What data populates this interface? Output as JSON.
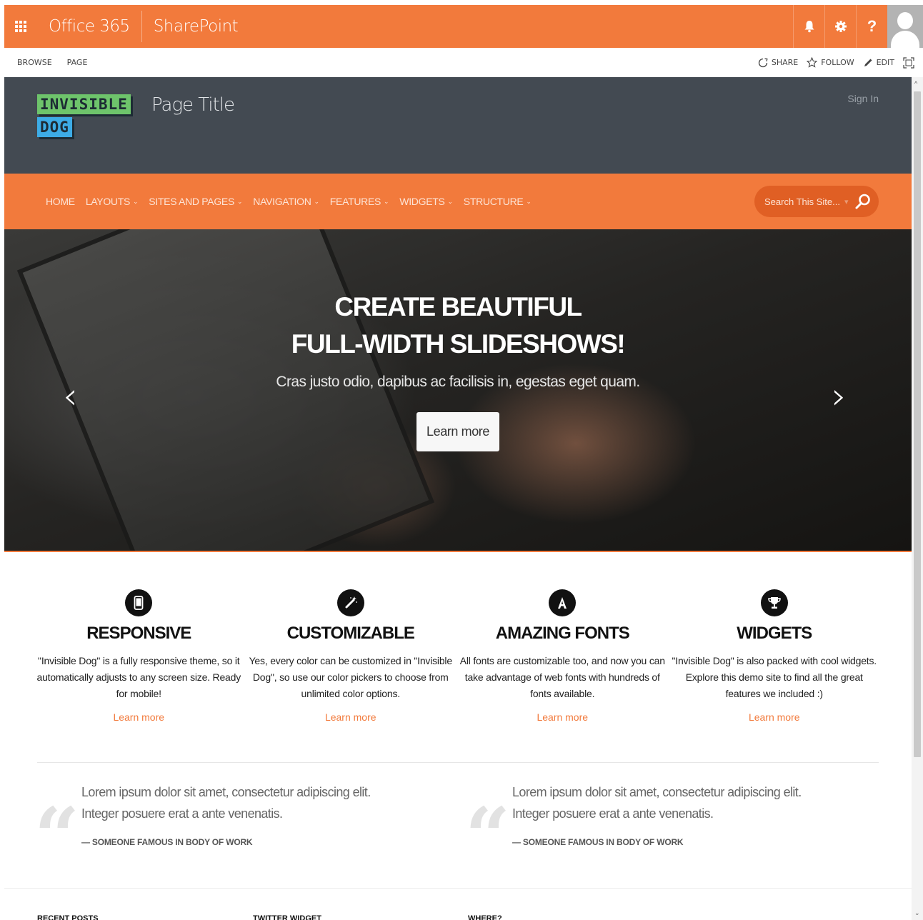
{
  "suite": {
    "brand": "Office 365",
    "app": "SharePoint",
    "help": "?"
  },
  "ribbon": {
    "tabs": [
      "BROWSE",
      "PAGE"
    ],
    "actions": {
      "share": "SHARE",
      "follow": "FOLLOW",
      "edit": "EDIT"
    }
  },
  "header": {
    "logo_line1": "INVISIBLE",
    "logo_line2": "DOG",
    "page_title": "Page Title",
    "sign_in": "Sign In"
  },
  "nav": {
    "items": [
      {
        "label": "HOME",
        "dropdown": false
      },
      {
        "label": "LAYOUTS",
        "dropdown": true
      },
      {
        "label": "SITES AND PAGES",
        "dropdown": true
      },
      {
        "label": "NAVIGATION",
        "dropdown": true
      },
      {
        "label": "FEATURES",
        "dropdown": true
      },
      {
        "label": "WIDGETS",
        "dropdown": true
      },
      {
        "label": "STRUCTURE",
        "dropdown": true
      }
    ],
    "search_placeholder": "Search This Site..."
  },
  "hero": {
    "title_line1": "CREATE BEAUTIFUL",
    "title_line2": "FULL-WIDTH SLIDESHOWS!",
    "subtitle": "Cras justo odio, dapibus ac facilisis in, egestas eget quam.",
    "button": "Learn more"
  },
  "features": [
    {
      "icon": "mobile-icon",
      "title": "RESPONSIVE",
      "text": "\"Invisible Dog\" is a fully responsive theme, so it automatically adjusts to any screen size. Ready for mobile!",
      "link": "Learn more"
    },
    {
      "icon": "magic-wand-icon",
      "title": "CUSTOMIZABLE",
      "text": "Yes, every color can be customized in \"Invisible Dog\", so use our color pickers to choose from unlimited color options.",
      "link": "Learn more"
    },
    {
      "icon": "font-icon",
      "title": "AMAZING FONTS",
      "text": "All fonts are customizable too, and now you can take advantage of web fonts with hundreds of fonts available.",
      "link": "Learn more"
    },
    {
      "icon": "trophy-icon",
      "title": "WIDGETS",
      "text": "\"Invisible Dog\" is also packed with cool widgets. Explore this demo site to find all the great features we included :)",
      "link": "Learn more"
    }
  ],
  "quotes": [
    {
      "text": "Lorem ipsum dolor sit amet, consectetur adipiscing elit. Integer posuere erat a ante venenatis.",
      "author": "— SOMEONE FAMOUS IN BODY OF WORK"
    },
    {
      "text": "Lorem ipsum dolor sit amet, consectetur adipiscing elit. Integer posuere erat a ante venenatis.",
      "author": "— SOMEONE FAMOUS IN BODY OF WORK"
    }
  ],
  "footer": {
    "columns": [
      "RECENT POSTS",
      "TWITTER WIDGET",
      "WHERE?"
    ]
  },
  "colors": {
    "accent": "#f27a3c",
    "header_bg": "#434a52",
    "logo_green": "#6ec46b",
    "logo_blue": "#3dace6"
  }
}
